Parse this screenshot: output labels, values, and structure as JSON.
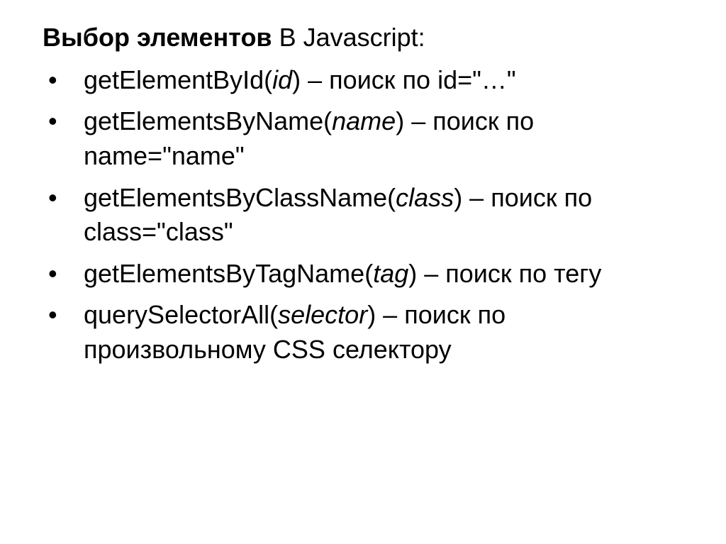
{
  "title": {
    "bold": "Выбор элементов",
    "rest": "  В Javascript:"
  },
  "items": [
    {
      "fn": "getElementById(",
      "arg": "id",
      "tail": ") – поиск по id=\"…\""
    },
    {
      "fn": "getElementsByName(",
      "arg": "name",
      "tail": ") – поиск по name=\"name\""
    },
    {
      "fn": "getElementsByClassName(",
      "arg": "class",
      "tail": ") – поиск по class=\"class\""
    },
    {
      "fn": "getElementsByTagName(",
      "arg": "tag",
      "tail": ") – поиск по тегу"
    },
    {
      "fn": "querySelectorAll(",
      "arg": "selector",
      "tail": ") – поиск по произвольному CSS селектору"
    }
  ]
}
